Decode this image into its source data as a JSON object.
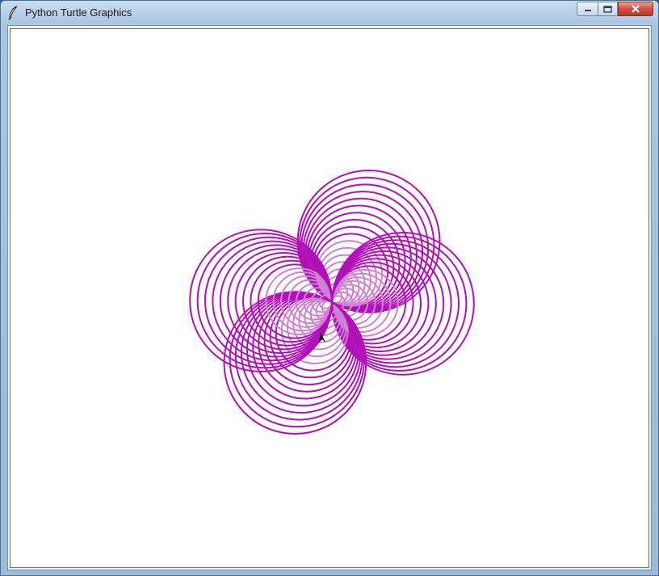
{
  "window": {
    "title": "Python Turtle Graphics",
    "icon": "feather-icon"
  },
  "controls": {
    "minimize_icon": "minimize-icon",
    "maximize_icon": "maximize-icon",
    "close_icon": "close-icon"
  },
  "drawing": {
    "pen_color": "#b010b8",
    "light_pen_color": "#cf80d2",
    "background": "#ffffff",
    "petals": 4,
    "circles_per_petal": 18,
    "cursor": "turtle-arrow-icon"
  }
}
